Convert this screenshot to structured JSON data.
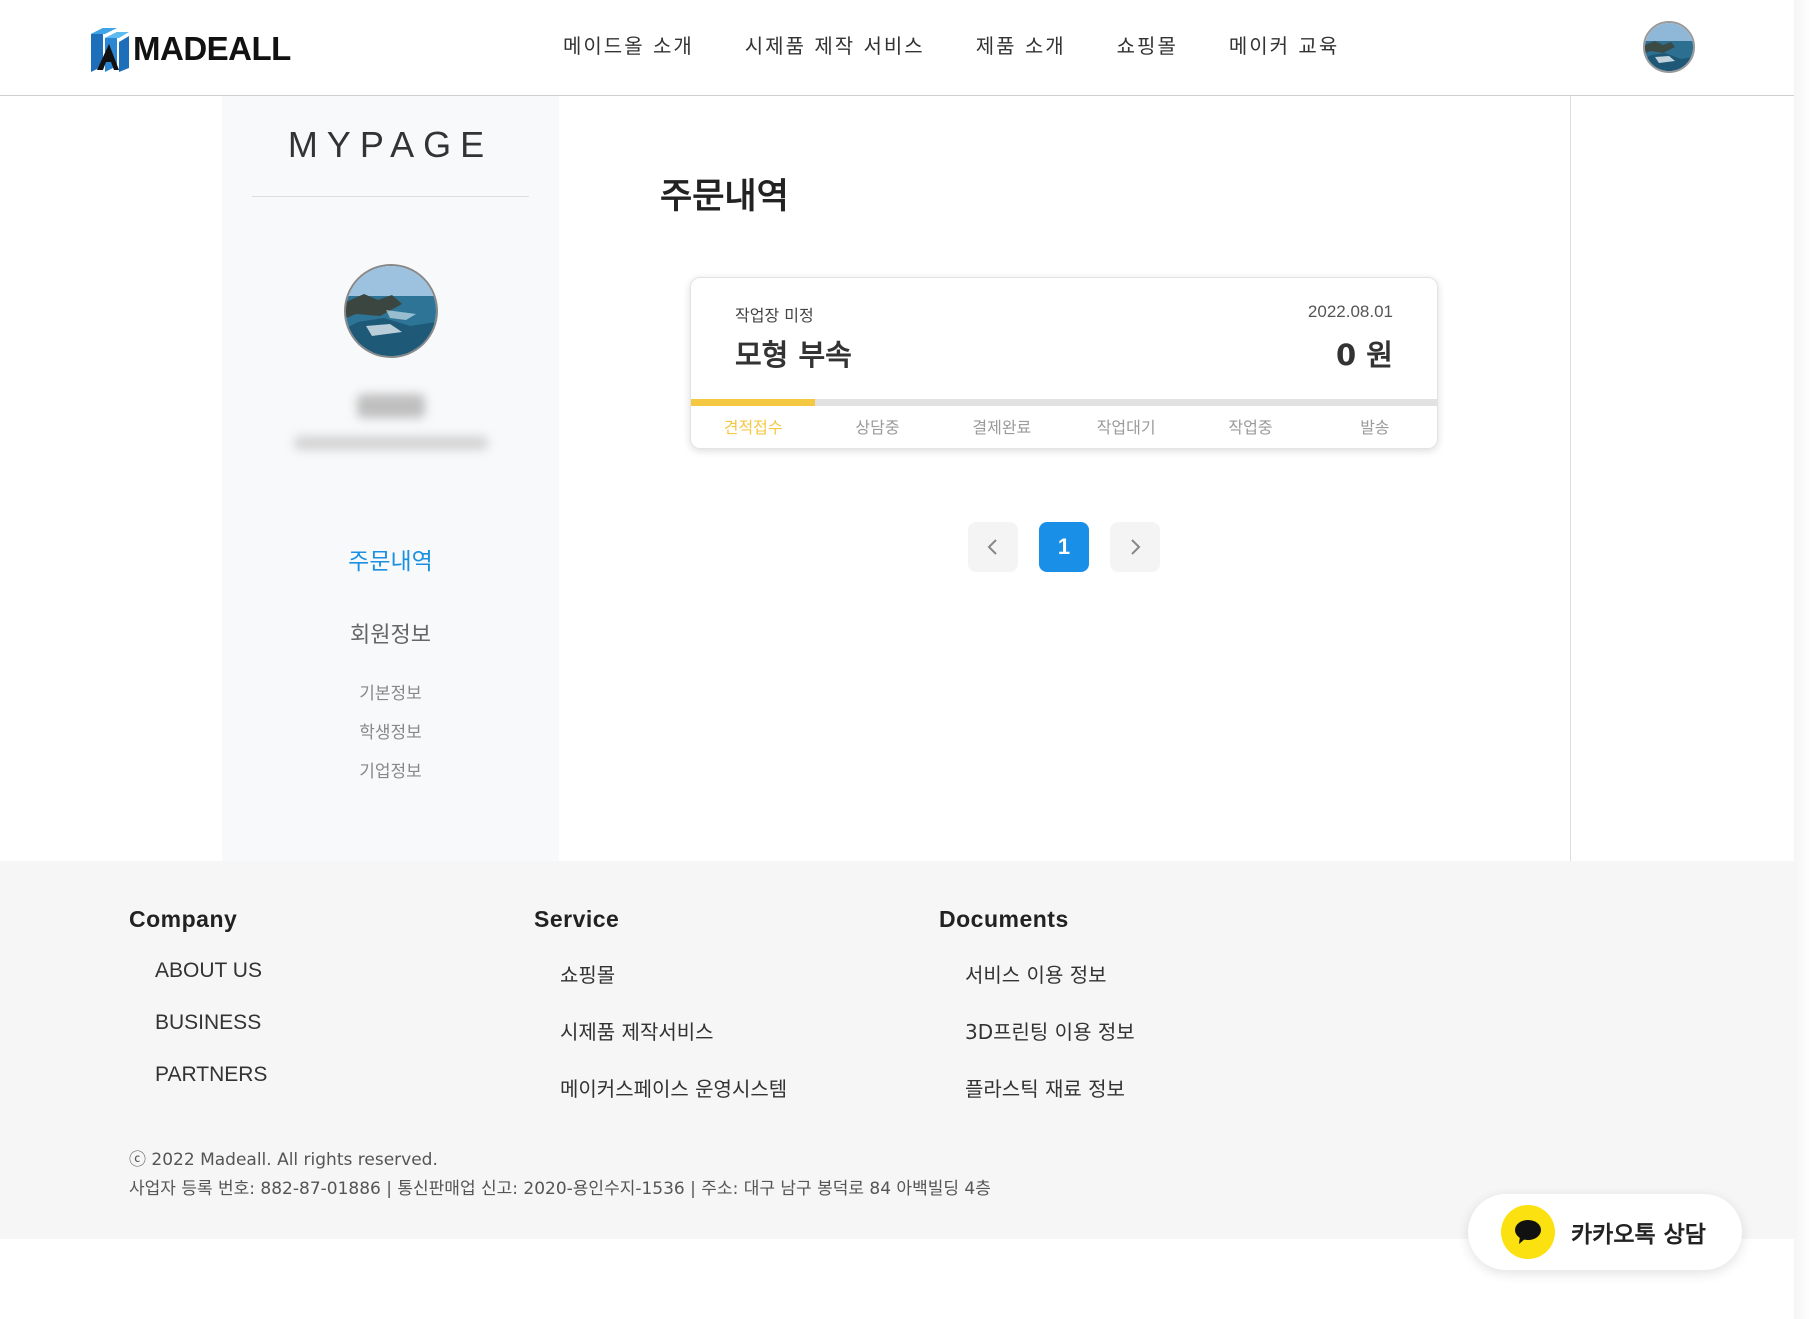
{
  "header": {
    "logo_text": "MADEALL",
    "nav": [
      "메이드올 소개",
      "시제품 제작 서비스",
      "제품 소개",
      "쇼핑몰",
      "메이커 교육"
    ]
  },
  "sidebar": {
    "title": "MYPAGE",
    "menu": {
      "orders": "주문내역",
      "member_info": "회원정보",
      "basic_info": "기본정보",
      "student_info": "학생정보",
      "company_info": "기업정보"
    }
  },
  "main": {
    "page_title": "주문내역",
    "order": {
      "workshop": "작업장 미정",
      "date": "2022.08.01",
      "product": "모형 부속",
      "price": "0 원",
      "steps": [
        "견적접수",
        "상담중",
        "결제완료",
        "작업대기",
        "작업중",
        "발송"
      ],
      "active_step": 0,
      "progress_fraction": 0.1667
    },
    "pagination": {
      "current_page": "1"
    }
  },
  "footer": {
    "company": {
      "heading": "Company",
      "links": [
        "ABOUT US",
        "BUSINESS",
        "PARTNERS"
      ]
    },
    "service": {
      "heading": "Service",
      "links": [
        "쇼핑몰",
        "시제품 제작서비스",
        "메이커스페이스 운영시스템"
      ]
    },
    "documents": {
      "heading": "Documents",
      "links": [
        "서비스 이용 정보",
        "3D프린팅 이용 정보",
        "플라스틱 재료 정보"
      ]
    },
    "copyright": "ⓒ 2022 Madeall. All rights reserved.",
    "business_info": "사업자 등록 번호: 882-87-01886 | 통신판매업 신고: 2020-용인수지-1536 | 주소: 대구 남구 봉덕로 84 아백빌딩 4층"
  },
  "kakao": {
    "label": "카카오톡 상담"
  },
  "colors": {
    "accent": "#1a8fe8",
    "progress": "#f5c842",
    "kakao": "#fbe10f"
  }
}
